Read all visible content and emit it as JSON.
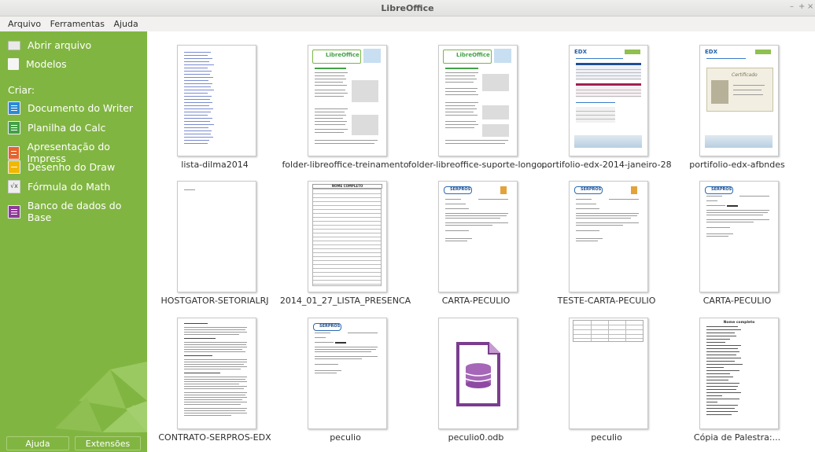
{
  "window": {
    "title": "LibreOffice"
  },
  "menu": {
    "items": [
      "Arquivo",
      "Ferramentas",
      "Ajuda"
    ]
  },
  "sidebar": {
    "open": "Abrir arquivo",
    "templates": "Modelos",
    "create_label": "Criar:",
    "create": [
      {
        "label": "Documento do Writer",
        "icon": "writer-icon"
      },
      {
        "label": "Planilha do Calc",
        "icon": "calc-icon"
      },
      {
        "label": "Apresentação do Impress",
        "icon": "impress-icon"
      },
      {
        "label": "Desenho do Draw",
        "icon": "draw-icon"
      },
      {
        "label": "Fórmula do Math",
        "icon": "math-icon"
      },
      {
        "label": "Banco de dados do Base",
        "icon": "base-icon"
      }
    ],
    "help": "Ajuda",
    "extensions": "Extensões"
  },
  "colors": {
    "sidebar": "#81b541",
    "accent": "#43a047"
  },
  "recent_files": [
    "lista-dilma2014",
    "folder-libreoffice-treinamento",
    "folder-libreoffice-suporte-longo...",
    "portifolio-edx-2014-janeiro-28",
    "portifolio-edx-afbndes",
    "HOSTGATOR-SETORIALRJ",
    "2014_01_27_LISTA_PRESENCA",
    "CARTA-PECULIO",
    "TESTE-CARTA-PECULIO",
    "CARTA-PECULIO",
    "CONTRATO-SERPROS-EDX",
    "peculio",
    "peculio0.odb",
    "peculio",
    "Cópia de Palestra:..."
  ],
  "thumb_text": {
    "libreoffice_logo": "LibreOffice",
    "edx_logo": "EDX",
    "serpros_logo": "SERPROS",
    "list_header": "NOME COMPLETO",
    "list_header2": "Nome completo",
    "certificate": "Certificado"
  }
}
